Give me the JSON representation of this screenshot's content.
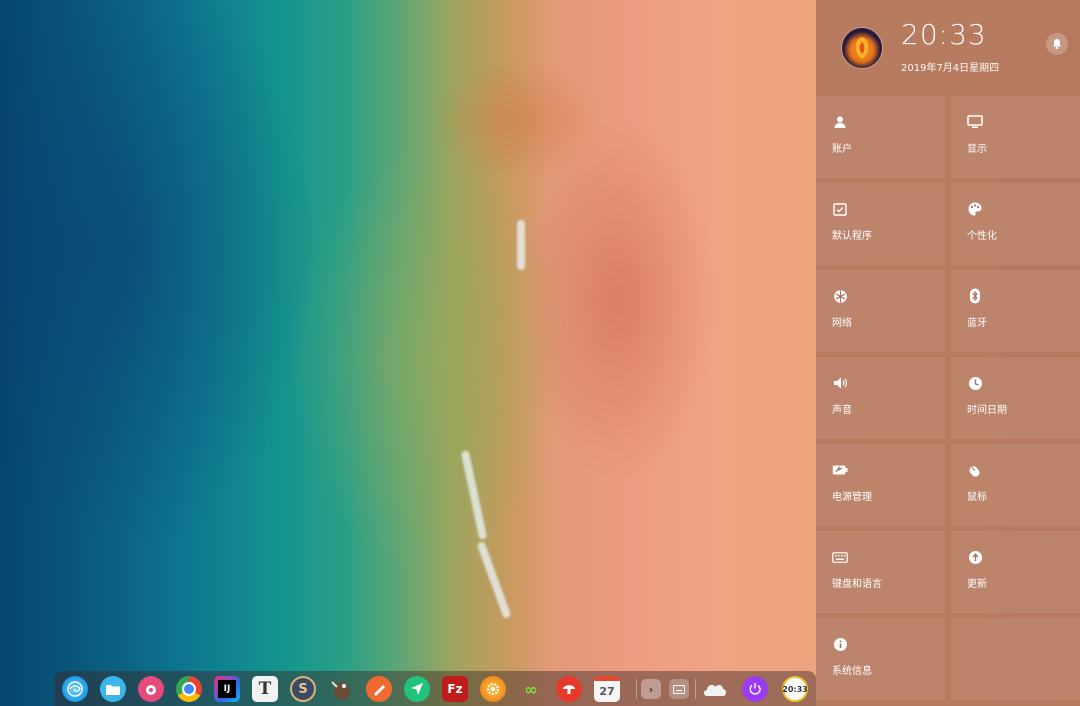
{
  "panel": {
    "time": "20:33",
    "date": "2019年7月4日星期四",
    "tiles": [
      {
        "id": "accounts",
        "label": "账户",
        "icon": "user-icon"
      },
      {
        "id": "display",
        "label": "显示",
        "icon": "monitor-icon"
      },
      {
        "id": "default-apps",
        "label": "默认程序",
        "icon": "default-apps-icon"
      },
      {
        "id": "personalization",
        "label": "个性化",
        "icon": "palette-icon"
      },
      {
        "id": "network",
        "label": "网络",
        "icon": "network-icon"
      },
      {
        "id": "bluetooth",
        "label": "蓝牙",
        "icon": "bluetooth-icon"
      },
      {
        "id": "sound",
        "label": "声音",
        "icon": "speaker-icon"
      },
      {
        "id": "datetime",
        "label": "时间日期",
        "icon": "clock-icon"
      },
      {
        "id": "power",
        "label": "电源管理",
        "icon": "battery-icon"
      },
      {
        "id": "mouse",
        "label": "鼠标",
        "icon": "mouse-icon"
      },
      {
        "id": "keyboard",
        "label": "键盘和语言",
        "icon": "keyboard-icon"
      },
      {
        "id": "update",
        "label": "更新",
        "icon": "update-icon"
      },
      {
        "id": "sysinfo",
        "label": "系统信息",
        "icon": "info-icon"
      }
    ]
  },
  "dock": {
    "calendar_day": "27",
    "clock_text": "20:33"
  },
  "colors": {
    "panel_bg": "#a87058",
    "text": "#ffffff"
  }
}
